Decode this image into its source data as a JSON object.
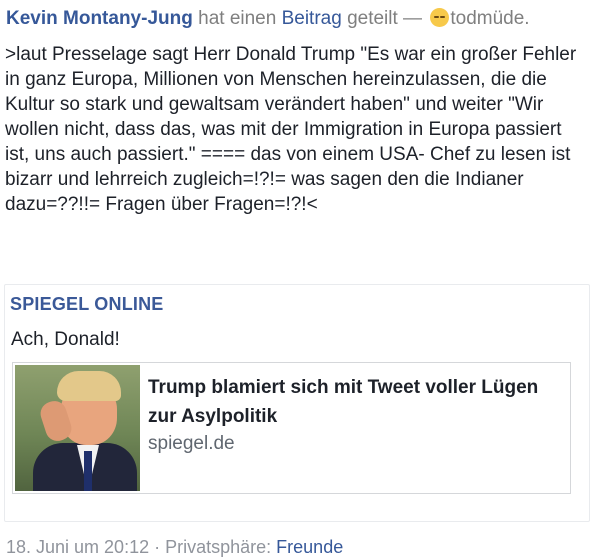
{
  "header": {
    "author": "Kevin Montany-Jung",
    "shared_text": " hat einen ",
    "post_link": "Beitrag",
    "shared_suffix": " geteilt — ",
    "feeling": "todmüde."
  },
  "post": {
    "text": ">laut Presselage sagt Herr Donald Trump \"Es war ein großer Fehler in ganz Europa, Millionen von Menschen hereinzulassen, die die Kultur so stark und gewaltsam verändert haben\" und weiter \"Wir wollen nicht, dass das, was mit der Immigration in Europa passiert ist, uns auch passiert.\" ==== das von einem USA- Chef zu lesen ist bizarr und lehrreich zugleich=!?!= was sagen den die Indianer dazu=??!!= Fragen über Fragen=!?!<"
  },
  "shared": {
    "source": "SPIEGEL ONLINE",
    "message": "Ach, Donald!",
    "link": {
      "title": "Trump blamiert sich mit Tweet voller Lügen zur Asylpolitik",
      "domain": "spiegel.de"
    }
  },
  "footer": {
    "timestamp": "18. Juni um 20:12",
    "separator": " · ",
    "privacy_label": "Privatsphäre: ",
    "privacy_value": "Freunde"
  },
  "colors": {
    "link_blue": "#365899",
    "source_blue": "#3b5998",
    "meta_gray": "#90949c"
  }
}
